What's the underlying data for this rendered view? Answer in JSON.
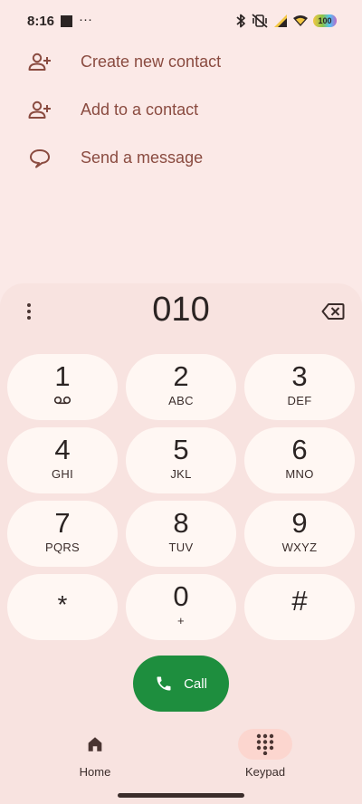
{
  "status_bar": {
    "time": "8:16",
    "overflow": "···",
    "battery": "100",
    "icons": [
      "stop-square-icon",
      "bluetooth-icon",
      "vibrate-off-icon",
      "signal-icon",
      "wifi-icon",
      "battery-icon"
    ]
  },
  "actions": [
    {
      "label": "Create new contact",
      "icon": "add-person-icon"
    },
    {
      "label": "Add to a contact",
      "icon": "add-person-icon"
    },
    {
      "label": "Send a message",
      "icon": "message-icon"
    }
  ],
  "dialer": {
    "number": "010",
    "keys": [
      {
        "digit": "1",
        "letters": "",
        "sub_icon": "voicemail-icon"
      },
      {
        "digit": "2",
        "letters": "ABC"
      },
      {
        "digit": "3",
        "letters": "DEF"
      },
      {
        "digit": "4",
        "letters": "GHI"
      },
      {
        "digit": "5",
        "letters": "JKL"
      },
      {
        "digit": "6",
        "letters": "MNO"
      },
      {
        "digit": "7",
        "letters": "PQRS"
      },
      {
        "digit": "8",
        "letters": "TUV"
      },
      {
        "digit": "9",
        "letters": "WXYZ"
      },
      {
        "digit": "*",
        "letters": ""
      },
      {
        "digit": "0",
        "letters": "+"
      },
      {
        "digit": "#",
        "letters": ""
      }
    ],
    "call_label": "Call"
  },
  "nav": {
    "home_label": "Home",
    "keypad_label": "Keypad",
    "active": "Keypad"
  },
  "colors": {
    "background": "#fbe9e7",
    "sheet": "#f8e3e0",
    "key": "#fff7f3",
    "accent_text": "#8a4b40",
    "call": "#1e8e3e",
    "active_nav": "#fcd6cf"
  }
}
